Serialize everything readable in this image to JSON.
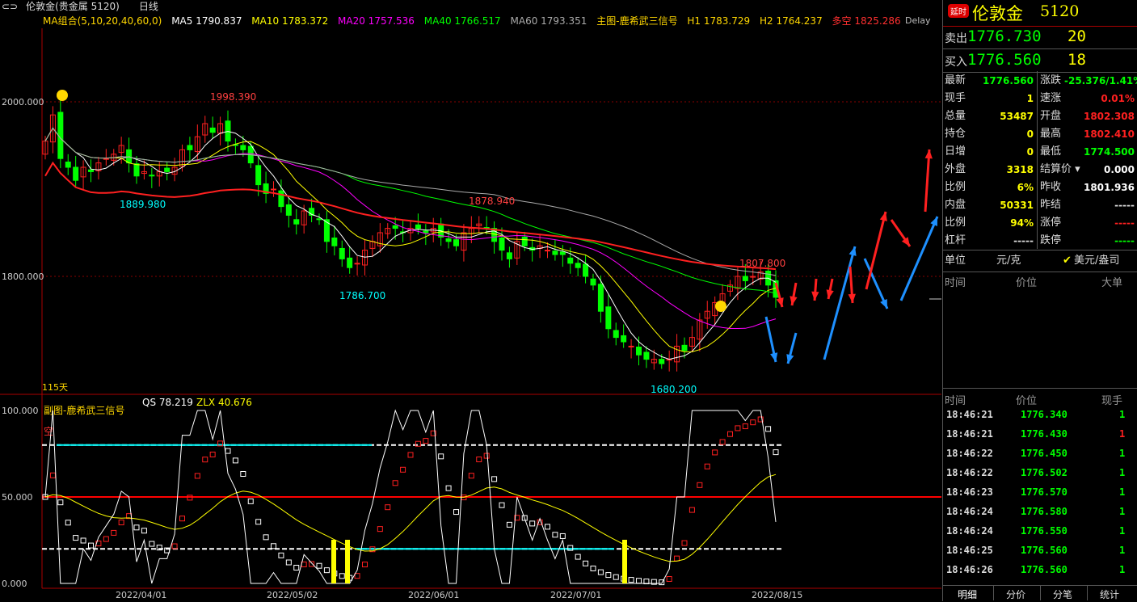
{
  "window": {
    "title_icon": "window-icon",
    "instrument": "伦敦金(贵金属 5120)",
    "period": "日线"
  },
  "legend": {
    "ma_group": "MA组合(5,10,20,40,60,0)",
    "ma5": "MA5 1790.837",
    "ma10": "MA10 1783.372",
    "ma20": "MA20 1757.536",
    "ma40": "MA40 1766.517",
    "ma60": "MA60 1793.351",
    "main_indicator": "主图-鹿希武三信号",
    "h1": "H1 1783.729",
    "h2": "H2 1764.237",
    "duokong": "多空 1825.286",
    "delay": "Delay"
  },
  "colors": {
    "up": "#ff2020",
    "down": "#00ff00",
    "ma5": "#ffffff",
    "ma10": "#ffff00",
    "ma20": "#ff00ff",
    "ma40": "#00ff00",
    "ma60": "#aaaaaa",
    "duokong": "#ff2020",
    "cyan": "#00ffff",
    "arrow_blue": "#1e90ff"
  },
  "main_chart": {
    "y_ticks": [
      "2000.000",
      "1800.000"
    ],
    "annotations": [
      {
        "text": "1998.390",
        "color": "#ff4040"
      },
      {
        "text": "1889.980",
        "color": "#00ffff"
      },
      {
        "text": "1878.940",
        "color": "#ff4040"
      },
      {
        "text": "1786.700",
        "color": "#00ffff"
      },
      {
        "text": "1807.800",
        "color": "#ff4040"
      },
      {
        "text": "1680.200",
        "color": "#00ffff"
      }
    ],
    "days_label": "115天"
  },
  "sub_chart": {
    "indicator": "副图-鹿希武三信号",
    "qs": "QS 78.219",
    "zlx": "ZLX 40.676",
    "y_ticks": [
      "100.000",
      "50.000",
      "0.000"
    ],
    "kong_label": "空"
  },
  "x_axis": [
    "2022/04/01",
    "2022/05/02",
    "2022/06/01",
    "2022/07/01",
    "2022/08/15"
  ],
  "right_panel": {
    "badge": "延时",
    "name": "伦敦金",
    "code": "5120",
    "sell": {
      "label": "卖出",
      "price": "1776.730",
      "qty": "20"
    },
    "buy": {
      "label": "买入",
      "price": "1776.560",
      "qty": "18"
    },
    "quotes_left": [
      {
        "label": "最新",
        "value": "1776.560",
        "color": "#00ff00"
      },
      {
        "label": "现手",
        "value": "1",
        "color": "#ffff00"
      },
      {
        "label": "总量",
        "value": "53487",
        "color": "#ffff00"
      },
      {
        "label": "持仓",
        "value": "0",
        "color": "#ffff00"
      },
      {
        "label": "日增",
        "value": "0",
        "color": "#ffff00"
      },
      {
        "label": "外盘",
        "value": "3318",
        "color": "#ffff00"
      },
      {
        "label": "比例",
        "value": "6%",
        "color": "#ffff00"
      },
      {
        "label": "内盘",
        "value": "50331",
        "color": "#ffff00"
      },
      {
        "label": "比例",
        "value": "94%",
        "color": "#ffff00"
      },
      {
        "label": "杠杆",
        "value": "-----",
        "color": "#dddddd"
      }
    ],
    "quotes_right": [
      {
        "label": "涨跌",
        "value": "-25.376/1.41%",
        "color": "#00ff00"
      },
      {
        "label": "速涨",
        "value": "0.01%",
        "color": "#ff2020"
      },
      {
        "label": "开盘",
        "value": "1802.308",
        "color": "#ff2020"
      },
      {
        "label": "最高",
        "value": "1802.410",
        "color": "#ff2020"
      },
      {
        "label": "最低",
        "value": "1774.500",
        "color": "#00ff00"
      },
      {
        "label": "结算价",
        "value": "0.000",
        "color": "#ffffff"
      },
      {
        "label": "昨收",
        "value": "1801.936",
        "color": "#ffffff"
      },
      {
        "label": "昨结",
        "value": "-----",
        "color": "#dddddd"
      },
      {
        "label": "涨停",
        "value": "-----",
        "color": "#ff2020"
      },
      {
        "label": "跌停",
        "value": "-----",
        "color": "#00ff00"
      }
    ],
    "unit_label": "单位",
    "unit_value": "元/克",
    "unit_option": "美元/盎司",
    "big_orders_headers": [
      "时间",
      "价位",
      "大单"
    ],
    "ticks_headers": [
      "时间",
      "价位",
      "现手"
    ],
    "ticks": [
      {
        "time": "18:46:21",
        "price": "1776.340",
        "qty": "1",
        "qcolor": "#00ff00"
      },
      {
        "time": "18:46:21",
        "price": "1776.430",
        "qty": "1",
        "qcolor": "#ff2020"
      },
      {
        "time": "18:46:22",
        "price": "1776.450",
        "qty": "1",
        "qcolor": "#00ff00"
      },
      {
        "time": "18:46:22",
        "price": "1776.502",
        "qty": "1",
        "qcolor": "#00ff00"
      },
      {
        "time": "18:46:23",
        "price": "1776.570",
        "qty": "1",
        "qcolor": "#00ff00"
      },
      {
        "time": "18:46:24",
        "price": "1776.580",
        "qty": "1",
        "qcolor": "#00ff00"
      },
      {
        "time": "18:46:24",
        "price": "1776.550",
        "qty": "1",
        "qcolor": "#00ff00"
      },
      {
        "time": "18:46:25",
        "price": "1776.560",
        "qty": "1",
        "qcolor": "#00ff00"
      },
      {
        "time": "18:46:26",
        "price": "1776.560",
        "qty": "1",
        "qcolor": "#00ff00"
      }
    ],
    "tabs": [
      "明细",
      "分价",
      "分笔",
      "统计"
    ]
  },
  "chart_data": {
    "type": "candlestick",
    "y_ticks_main": [
      2000,
      1800
    ],
    "y_ticks_sub": [
      100,
      50,
      0
    ],
    "closes": [
      1955,
      1985,
      1935,
      1925,
      1910,
      1925,
      1920,
      1930,
      1935,
      1940,
      1950,
      1930,
      1915,
      1920,
      1915,
      1920,
      1920,
      1925,
      1945,
      1945,
      1960,
      1975,
      1965,
      1975,
      1955,
      1950,
      1945,
      1930,
      1905,
      1895,
      1900,
      1880,
      1870,
      1860,
      1875,
      1870,
      1865,
      1840,
      1835,
      1820,
      1810,
      1815,
      1830,
      1840,
      1850,
      1855,
      1855,
      1850,
      1855,
      1855,
      1850,
      1855,
      1845,
      1840,
      1835,
      1850,
      1855,
      1860,
      1855,
      1840,
      1830,
      1820,
      1840,
      1835,
      1830,
      1835,
      1830,
      1825,
      1825,
      1815,
      1810,
      1800,
      1790,
      1760,
      1740,
      1730,
      1725,
      1720,
      1710,
      1705,
      1705,
      1700,
      1705,
      1720,
      1715,
      1730,
      1750,
      1760,
      1770,
      1780,
      1790,
      1800,
      1795,
      1800,
      1805,
      1790,
      1776
    ]
  }
}
